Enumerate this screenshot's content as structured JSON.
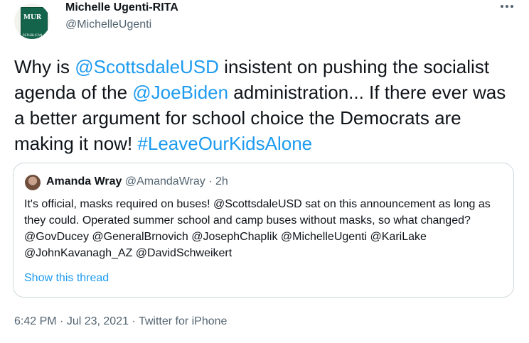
{
  "author": {
    "name": "Michelle Ugenti-RITA",
    "handle": "@MichelleUgenti",
    "avatar_text": "MUR",
    "avatar_subtext": "REPUBLICAN"
  },
  "more_icon": "more-dots-icon",
  "tweet": {
    "t1": "Why is ",
    "m1": "@ScottsdaleUSD",
    "t2": " insistent on pushing the socialist agenda of the ",
    "m2": "@JoeBiden",
    "t3": " administration... If there ever was a better argument for school choice the Democrats are making it now! ",
    "hashtag": "#LeaveOurKidsAlone"
  },
  "quote": {
    "name": "Amanda Wray",
    "handle": "@AmandaWray",
    "separator": " · ",
    "time": "2h",
    "text": "It's official, masks required on buses! @ScottsdaleUSD sat on this announcement as long as they could. Operated summer school and camp buses without masks, so what changed? @GovDucey @GeneralBrnovich @JosephChaplik @MichelleUgenti @KariLake @JohnKavanagh_AZ @DavidSchweikert",
    "show_thread": "Show this thread"
  },
  "meta": {
    "time": "6:42 PM",
    "sep1": " · ",
    "date": "Jul 23, 2021",
    "sep2": " · ",
    "source": "Twitter for iPhone"
  },
  "colors": {
    "link": "#1d9bf0",
    "text": "#0f1419",
    "secondary": "#536471",
    "border": "#cfd9de",
    "logo_green": "#13644a"
  }
}
